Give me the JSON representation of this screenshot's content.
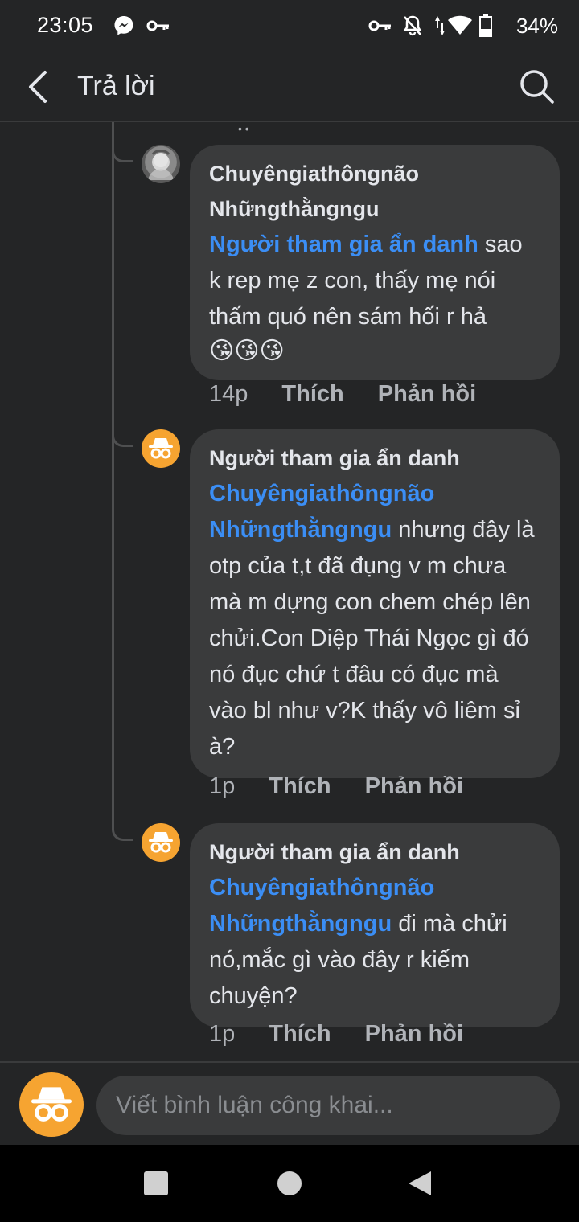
{
  "status_bar": {
    "time": "23:05",
    "battery": "34%",
    "icons": [
      "messenger-icon",
      "vpn-key-icon",
      "key-icon",
      "notifications-off-icon",
      "data-arrows-icon",
      "wifi-icon",
      "battery-icon"
    ]
  },
  "app_bar": {
    "title": "Trả lời",
    "back_icon": "chevron-left-icon",
    "search_icon": "search-icon"
  },
  "comments": [
    {
      "author": "Chuyêngiathôngnão Nhữngthằngngu",
      "avatar": "photo",
      "mention": "Người tham gia ẩn danh",
      "text": " sao k rep mẹ z con, thấy mẹ nói thấm quó nên sám hối r hả",
      "emoji": "😘😘😘",
      "time": "14p",
      "like_label": "Thích",
      "reply_label": "Phản hồi"
    },
    {
      "author": "Người tham gia ẩn danh",
      "avatar": "anonymous",
      "mention": "Chuyêngiathôngnão Nhữngthằngngu",
      "text": " nhưng đây là otp của t,t đã đụng v m chưa mà m dựng con chem chép lên chửi.Con Diệp Thái Ngọc gì đó nó đục chứ t đâu có đục mà vào bl như v?K thấy vô liêm sỉ à?",
      "time": "1p",
      "like_label": "Thích",
      "reply_label": "Phản hồi"
    },
    {
      "author": "Người tham gia ẩn danh",
      "avatar": "anonymous",
      "mention": "Chuyêngiathôngnão Nhữngthằngngu",
      "text": " đi mà chửi nó,mắc gì vào đây r kiếm chuyện?",
      "time": "1p",
      "like_label": "Thích",
      "reply_label": "Phản hồi"
    }
  ],
  "composer": {
    "placeholder": "Viết bình luận công khai..."
  },
  "nav": {
    "recents_icon": "square-recents-icon",
    "home_icon": "circle-home-icon",
    "back_icon": "triangle-back-icon"
  },
  "colors": {
    "background": "#242526",
    "bubble": "#3a3b3c",
    "mention": "#3b8ef5",
    "anon_avatar": "#f6a431"
  }
}
